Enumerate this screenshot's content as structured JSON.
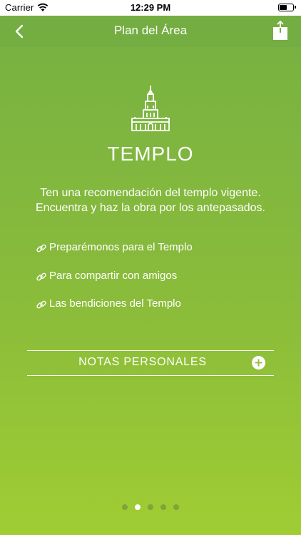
{
  "status_bar": {
    "carrier": "Carrier",
    "time": "12:29 PM",
    "battery_level": 0.6
  },
  "nav": {
    "title": "Plan del Área",
    "back_icon": "chevron-left-icon",
    "share_icon": "share-icon"
  },
  "content": {
    "icon": "temple-icon",
    "heading": "TEMPLO",
    "description_line1": "Ten una recomendación del templo vigente.",
    "description_line2": "Encuentra y haz la obra por los antepasados.",
    "links": [
      {
        "label": "Preparémonos para el Templo",
        "icon": "link-icon"
      },
      {
        "label": "Para compartir con amigos",
        "icon": "link-icon"
      },
      {
        "label": "Las bendiciones del Templo",
        "icon": "link-icon"
      }
    ],
    "notes": {
      "label": "NOTAS PERSONALES",
      "icon": "plus-circle-icon"
    }
  },
  "pager": {
    "total": 5,
    "active_index": 1
  },
  "colors": {
    "background_top": "#77b042",
    "background_bottom": "#9fcd33",
    "nav_bar": "#74ad41",
    "text": "#ffffff"
  }
}
